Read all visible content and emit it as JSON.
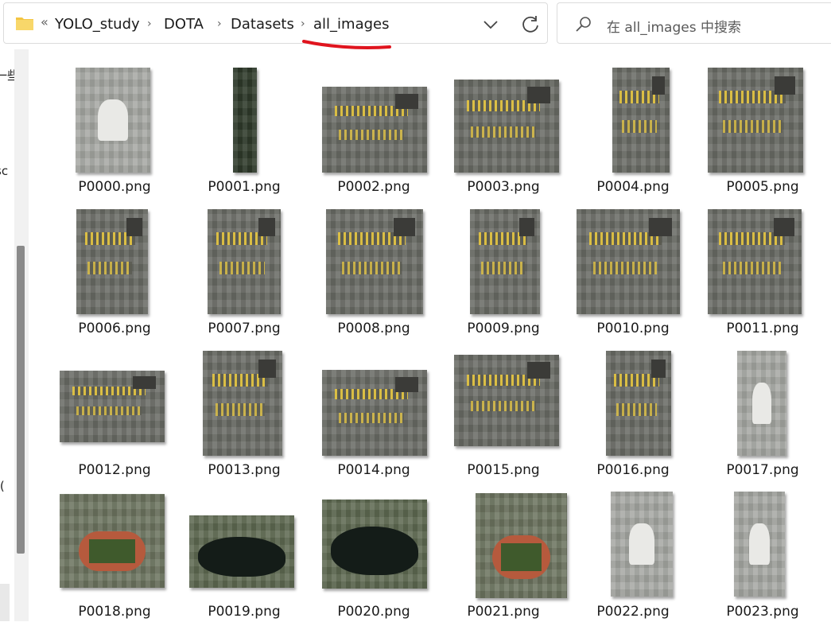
{
  "address_bar": {
    "more_glyph": "«",
    "breadcrumbs": [
      "YOLO_study",
      "DOTA",
      "Datasets",
      "all_images"
    ],
    "separator": "›"
  },
  "search": {
    "placeholder": "在 all_images 中搜索"
  },
  "left_pane_clipped_text": [
    "一些",
    "sc",
    ")("
  ],
  "accent_colors": {
    "annotation_underline": "#e0141e",
    "folder_yellow": "#f4c542",
    "parking_yellow": "#e6c640"
  },
  "files": [
    {
      "name": "P0000.png",
      "style": "airport"
    },
    {
      "name": "P0001.png",
      "style": "strip"
    },
    {
      "name": "P0002.png",
      "style": "lot"
    },
    {
      "name": "P0003.png",
      "style": "lot"
    },
    {
      "name": "P0004.png",
      "style": "lot"
    },
    {
      "name": "P0005.png",
      "style": "lot"
    },
    {
      "name": "P0006.png",
      "style": "lot"
    },
    {
      "name": "P0007.png",
      "style": "lot"
    },
    {
      "name": "P0008.png",
      "style": "lot"
    },
    {
      "name": "P0009.png",
      "style": "lot"
    },
    {
      "name": "P0010.png",
      "style": "lot"
    },
    {
      "name": "P0011.png",
      "style": "lot"
    },
    {
      "name": "P0012.png",
      "style": "lot"
    },
    {
      "name": "P0013.png",
      "style": "lot"
    },
    {
      "name": "P0014.png",
      "style": "lot"
    },
    {
      "name": "P0015.png",
      "style": "lot"
    },
    {
      "name": "P0016.png",
      "style": "lot"
    },
    {
      "name": "P0017.png",
      "style": "airport"
    },
    {
      "name": "P0018.png",
      "style": "stadium"
    },
    {
      "name": "P0019.png",
      "style": "lake"
    },
    {
      "name": "P0020.png",
      "style": "lake"
    },
    {
      "name": "P0021.png",
      "style": "stadium"
    },
    {
      "name": "P0022.png",
      "style": "airport"
    },
    {
      "name": "P0023.png",
      "style": "airport"
    }
  ]
}
